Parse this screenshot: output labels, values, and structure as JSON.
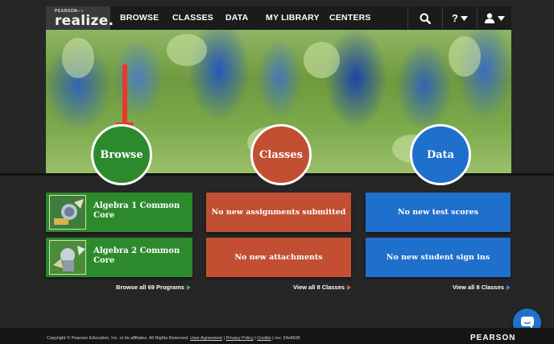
{
  "nav": {
    "logo_small": "PEARSON",
    "logo_main": "realize.",
    "items": [
      "BROWSE",
      "CLASSES",
      "DATA",
      "MY LIBRARY",
      "CENTERS"
    ],
    "help_label": "?"
  },
  "hero": {
    "circles": [
      {
        "label": "Browse",
        "color": "#2c8a2c"
      },
      {
        "label": "Classes",
        "color": "#c24f32"
      },
      {
        "label": "Data",
        "color": "#1f6fcc"
      }
    ]
  },
  "programs": [
    {
      "title": "Algebra 1 Common Core"
    },
    {
      "title": "Algebra 2 Common Core"
    }
  ],
  "classes_cards": [
    "No new assignments submitted",
    "No new attachments"
  ],
  "data_cards": [
    "No new test scores",
    "No new student sign ins"
  ],
  "links": {
    "browse_all": "Browse all 69 Programs",
    "view_classes": "View all 8 Classes",
    "view_data": "View all 8 Classes"
  },
  "footer": {
    "copyright": "Copyright © Pearson Education, Inc. or its affiliates. All Rights Reserved.",
    "user_agreement": "User Agreement",
    "privacy": "Privacy Policy",
    "credits": "Credits",
    "rev": "rev. 24e8936",
    "sep1": "|",
    "sep2": "|",
    "sep3": "|",
    "brand": "PEARSON"
  },
  "colors": {
    "green": "#2c8a2c",
    "orange": "#c24f32",
    "blue": "#1f6fcc",
    "dark_bg": "#262626"
  },
  "icons": [
    "search-icon",
    "help-icon",
    "chevron-down-icon",
    "user-icon",
    "chat-icon"
  ]
}
